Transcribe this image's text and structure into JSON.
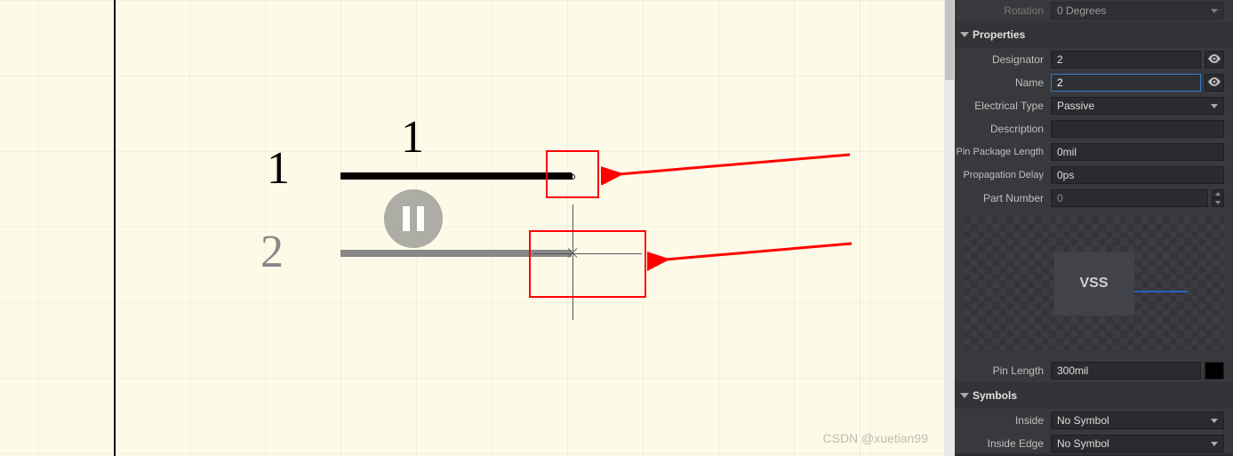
{
  "canvas": {
    "pin1_top_number": "1",
    "pin1_left_number": "1",
    "pin2_number": "2"
  },
  "panel": {
    "rotation": {
      "label": "Rotation",
      "value": "0 Degrees"
    },
    "properties_header": "Properties",
    "designator": {
      "label": "Designator",
      "value": "2"
    },
    "name": {
      "label": "Name",
      "value": "2"
    },
    "electrical_type": {
      "label": "Electrical Type",
      "value": "Passive"
    },
    "description": {
      "label": "Description",
      "value": ""
    },
    "pin_package_length": {
      "label": "Pin Package Length",
      "value": "0mil"
    },
    "propagation_delay": {
      "label": "Propagation Delay",
      "value": "0ps"
    },
    "part_number": {
      "label": "Part Number",
      "value": "0"
    },
    "preview_pin_name": "VSS",
    "pin_length": {
      "label": "Pin Length",
      "value": "300mil"
    },
    "symbols_header": "Symbols",
    "inside": {
      "label": "Inside",
      "value": "No Symbol"
    },
    "inside_edge": {
      "label": "Inside Edge",
      "value": "No Symbol"
    }
  },
  "watermark": "CSDN @xuetian99"
}
